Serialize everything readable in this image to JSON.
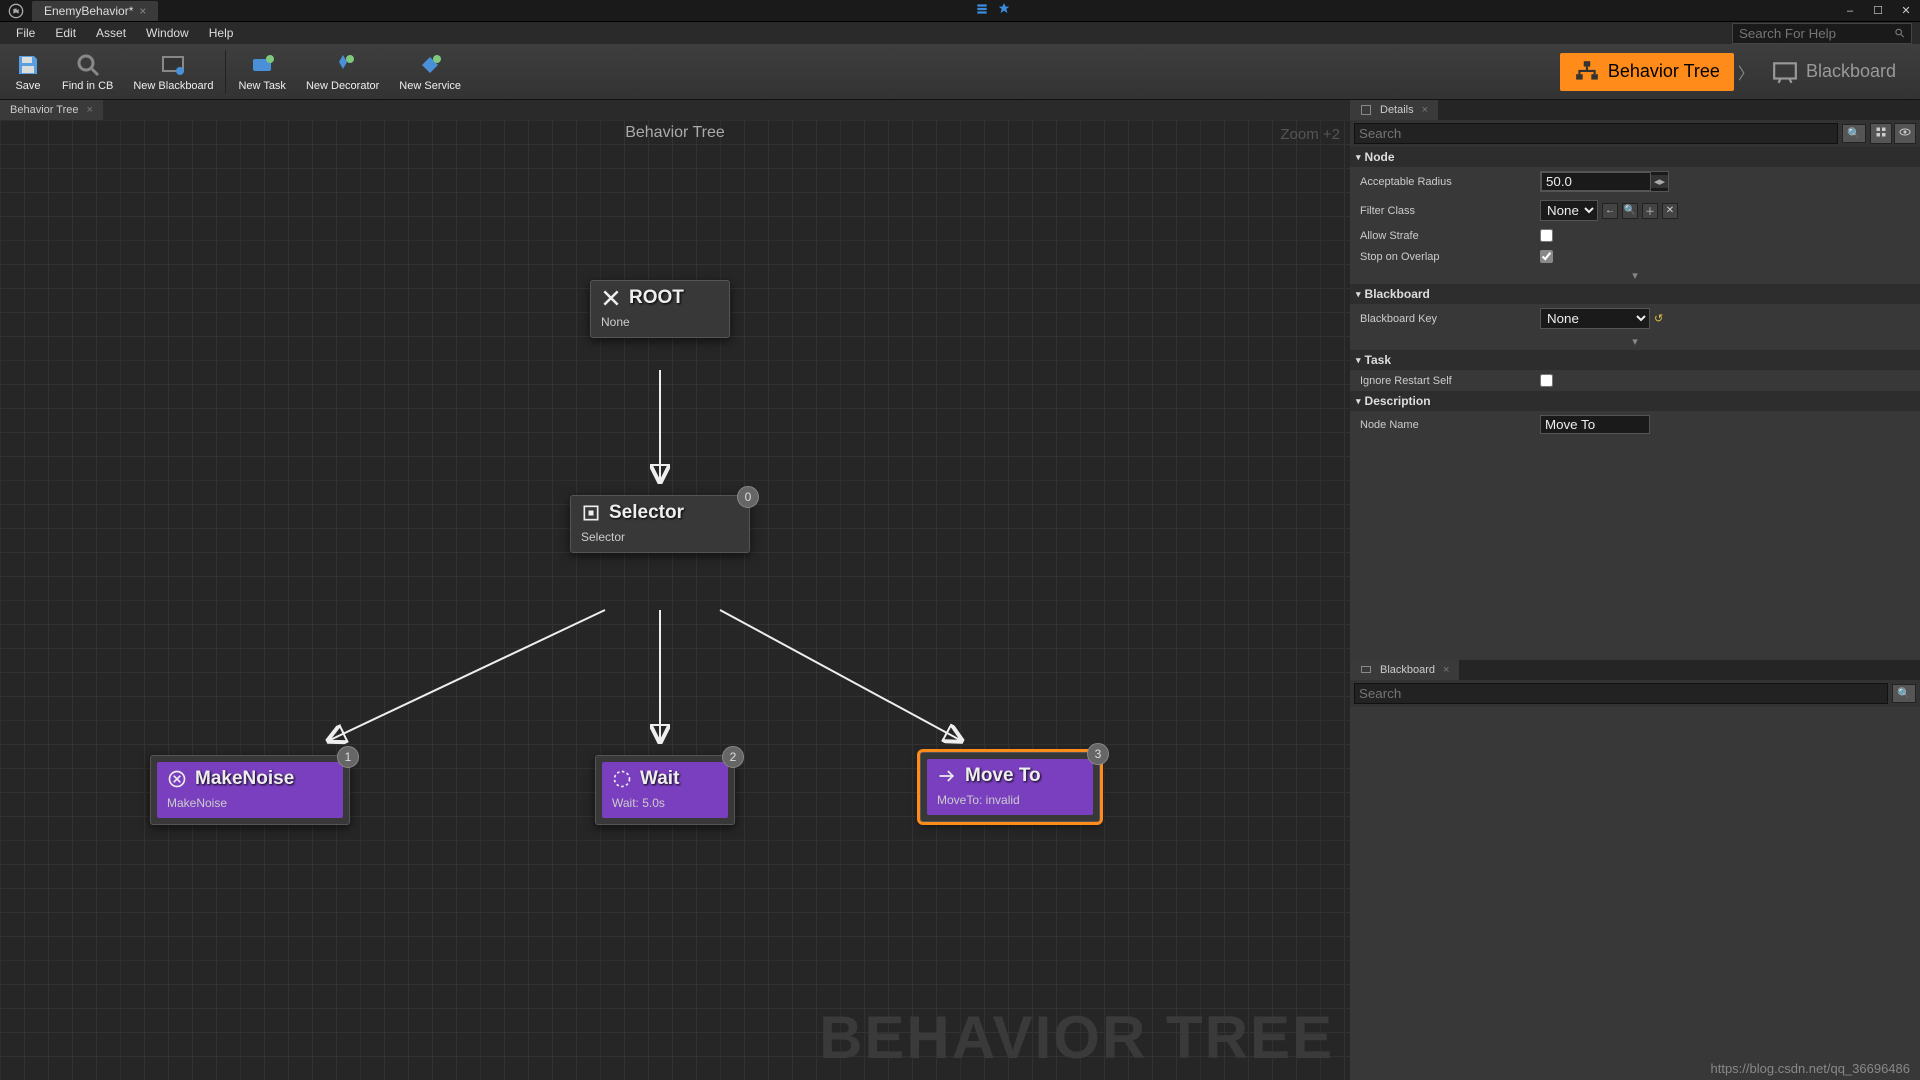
{
  "titlebar": {
    "tab": "EnemyBehavior*",
    "min": "–",
    "max": "☐",
    "close": "✕"
  },
  "menu": {
    "file": "File",
    "edit": "Edit",
    "asset": "Asset",
    "window": "Window",
    "help": "Help",
    "search_ph": "Search For Help"
  },
  "toolbar": {
    "save": "Save",
    "find": "Find in CB",
    "newbb": "New Blackboard",
    "newtask": "New Task",
    "newdec": "New Decorator",
    "newsvc": "New Service",
    "mode_bt": "Behavior Tree",
    "mode_bb": "Blackboard"
  },
  "graph": {
    "tab": "Behavior Tree",
    "title": "Behavior Tree",
    "zoom": "Zoom +2",
    "watermark": "BEHAVIOR TREE",
    "nodes": {
      "root": {
        "title": "ROOT",
        "sub": "None"
      },
      "selector": {
        "title": "Selector",
        "sub": "Selector",
        "badge": "0"
      },
      "noise": {
        "title": "MakeNoise",
        "sub": "MakeNoise",
        "badge": "1"
      },
      "wait": {
        "title": "Wait",
        "sub": "Wait: 5.0s",
        "badge": "2"
      },
      "move": {
        "title": "Move To",
        "sub": "MoveTo: invalid",
        "badge": "3"
      }
    }
  },
  "details": {
    "tab": "Details",
    "search_ph": "Search",
    "sec_node": "Node",
    "acc_radius_l": "Acceptable Radius",
    "acc_radius_v": "50.0",
    "filter_l": "Filter Class",
    "filter_v": "None",
    "strafe_l": "Allow Strafe",
    "overlap_l": "Stop on Overlap",
    "sec_bb": "Blackboard",
    "bbkey_l": "Blackboard Key",
    "bbkey_v": "None",
    "sec_task": "Task",
    "ignore_l": "Ignore Restart Self",
    "sec_desc": "Description",
    "nodename_l": "Node Name",
    "nodename_v": "Move To"
  },
  "blackboard": {
    "tab": "Blackboard",
    "search_ph": "Search"
  },
  "footer_url": "https://blog.csdn.net/qq_36696486"
}
